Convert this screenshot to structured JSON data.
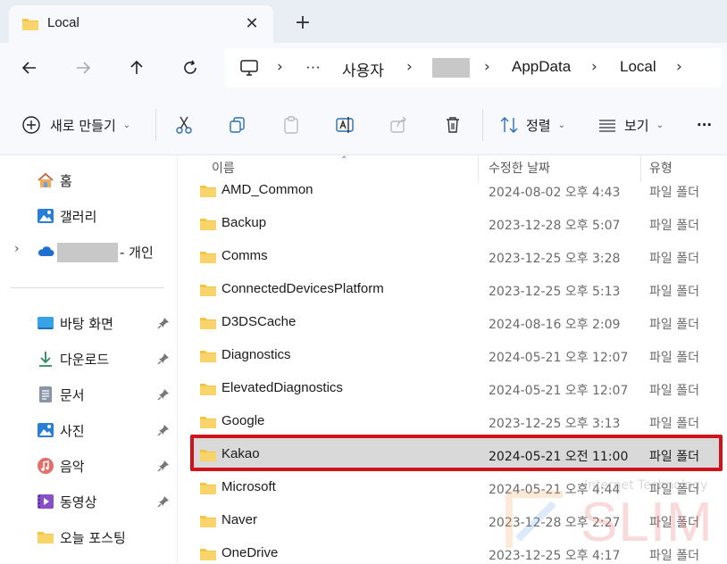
{
  "window": {
    "tab_title": "Local",
    "close_glyph": "✕",
    "new_tab_glyph": "+"
  },
  "nav": {
    "breadcrumb": [
      "사용자",
      "AppData",
      "Local"
    ],
    "ellipsis": "···"
  },
  "toolbar": {
    "new_label": "새로 만들기",
    "sort_label": "정렬",
    "view_label": "보기",
    "more_glyph": "···"
  },
  "sidebar": {
    "home": "홈",
    "gallery": "갤러리",
    "onedrive_suffix": "- 개인",
    "pinned": [
      {
        "label": "바탕 화면",
        "icon": "desktop-icon"
      },
      {
        "label": "다운로드",
        "icon": "download-icon"
      },
      {
        "label": "문서",
        "icon": "document-icon"
      },
      {
        "label": "사진",
        "icon": "pictures-icon"
      },
      {
        "label": "음악",
        "icon": "music-icon"
      },
      {
        "label": "동영상",
        "icon": "video-icon"
      },
      {
        "label": "오늘 포스팅",
        "icon": "folder-icon"
      }
    ]
  },
  "columns": {
    "name": "이름",
    "date": "수정한 날짜",
    "type": "유형"
  },
  "files": [
    {
      "name": "AMD_Common",
      "date": "2024-08-02 오후 4:43",
      "type": "파일 폴더"
    },
    {
      "name": "Backup",
      "date": "2023-12-28 오후 5:07",
      "type": "파일 폴더"
    },
    {
      "name": "Comms",
      "date": "2023-12-25 오후 3:28",
      "type": "파일 폴더"
    },
    {
      "name": "ConnectedDevicesPlatform",
      "date": "2023-12-25 오후 5:13",
      "type": "파일 폴더"
    },
    {
      "name": "D3DSCache",
      "date": "2024-08-16 오후 2:09",
      "type": "파일 폴더"
    },
    {
      "name": "Diagnostics",
      "date": "2024-05-21 오후 12:07",
      "type": "파일 폴더"
    },
    {
      "name": "ElevatedDiagnostics",
      "date": "2024-05-21 오후 12:07",
      "type": "파일 폴더"
    },
    {
      "name": "Google",
      "date": "2023-12-25 오후 3:13",
      "type": "파일 폴더"
    },
    {
      "name": "Kakao",
      "date": "2024-05-21 오전 11:00",
      "type": "파일 폴더"
    },
    {
      "name": "Microsoft",
      "date": "2024-05-21 오후 4:44",
      "type": "파일 폴더"
    },
    {
      "name": "Naver",
      "date": "2023-12-28 오후 2:27",
      "type": "파일 폴더"
    },
    {
      "name": "OneDrive",
      "date": "2023-12-25 오후 4:17",
      "type": "파일 폴더"
    }
  ],
  "selected_index": 8,
  "colors": {
    "folder": "#f4c542",
    "highlight": "#d0121b",
    "selection": "#d9d9d9"
  },
  "watermark": {
    "text": "SLIM",
    "sub": "Internet Technology"
  }
}
